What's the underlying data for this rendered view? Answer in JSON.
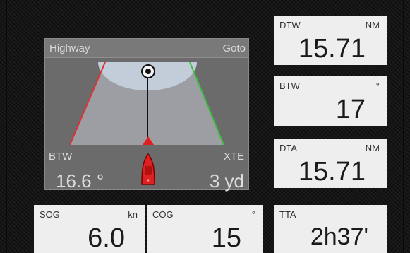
{
  "highway": {
    "title": "Highway",
    "mode": "Goto",
    "btw_label": "BTW",
    "btw_value": "16.6 °",
    "xte_label": "XTE",
    "xte_value": "3 yd"
  },
  "tiles": {
    "dtw": {
      "label": "DTW",
      "unit": "NM",
      "value": "15.71"
    },
    "btw": {
      "label": "BTW",
      "unit": "°",
      "value": "17"
    },
    "dta": {
      "label": "DTA",
      "unit": "NM",
      "value": "15.71"
    },
    "tta": {
      "label": "TTA",
      "unit": "",
      "value": "2h37'"
    },
    "sog": {
      "label": "SOG",
      "unit": "kn",
      "value": "6.0"
    },
    "cog": {
      "label": "COG",
      "unit": "°",
      "value": "15"
    }
  },
  "colors": {
    "port_line": "#e03030",
    "starboard_line": "#3cc040",
    "boat": "#e02020",
    "background": "#141414",
    "tile_bg": "#eeeeee"
  },
  "icons": {
    "waypoint": "waypoint-target-icon",
    "vessel": "boat-icon",
    "course_marker": "course-triangle-icon"
  }
}
